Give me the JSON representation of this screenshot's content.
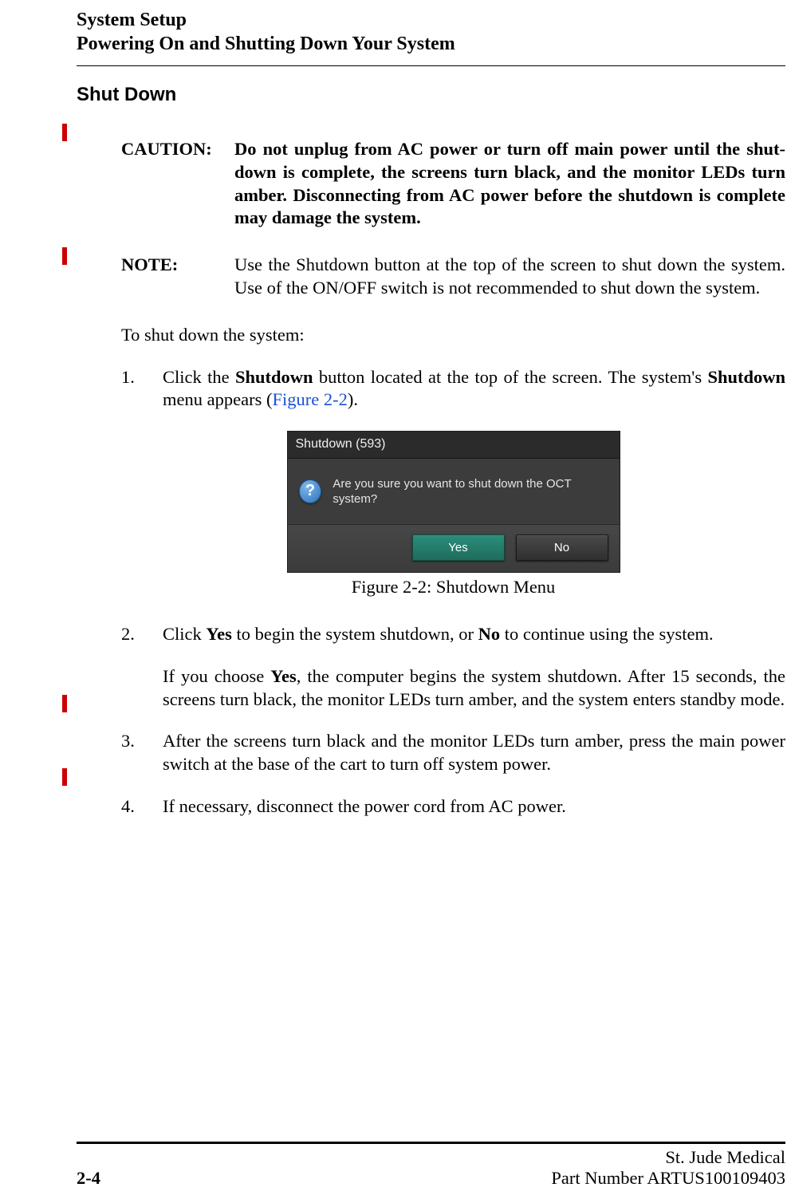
{
  "header": {
    "line1": "System Setup",
    "line2": "Powering On and Shutting Down Your System"
  },
  "section_title": "Shut Down",
  "caution": {
    "label": "CAUTION:",
    "text": "Do not unplug from AC power or turn off main power until the shut-down is complete, the screens turn black, and the monitor LEDs turn amber. Disconnecting from AC power before the shutdown is complete may damage the system."
  },
  "note": {
    "label": "NOTE:",
    "text": "Use the Shutdown button at the top of the screen to shut down the system. Use of the ON/OFF switch is not recommended to shut down the system."
  },
  "intro": "To shut down the system:",
  "step1": {
    "num": "1.",
    "pre": "Click the ",
    "b1": "Shutdown",
    "mid": " button located at the top of the screen. The system's ",
    "b2": "Shutdown",
    "post1": " menu appears (",
    "link": "Figure 2-2",
    "post2": ")."
  },
  "dialog": {
    "title": "Shutdown (593)",
    "icon_glyph": "?",
    "message": "Are you sure you want to shut down the OCT system?",
    "yes": "Yes",
    "no": "No"
  },
  "figure_caption": "Figure 2-2:  Shutdown Menu",
  "step2": {
    "num": "2.",
    "pre": "Click ",
    "b1": "Yes",
    "mid": " to begin the system shutdown, or ",
    "b2": "No",
    "post": " to continue using the system.",
    "para2_pre": "If you choose ",
    "para2_b": "Yes",
    "para2_post": ", the computer begins the system shutdown. After 15 seconds, the screens turn black, the monitor LEDs turn amber, and the system enters standby mode."
  },
  "step3": {
    "num": "3.",
    "text": "After the screens turn black and the monitor LEDs turn amber, press the main power switch at the base of the cart to turn off system power."
  },
  "step4": {
    "num": "4.",
    "text": "If necessary, disconnect the power cord from AC power."
  },
  "footer": {
    "page": "2-4",
    "org": "St. Jude Medical",
    "part": "Part Number ARTUS100109403"
  }
}
